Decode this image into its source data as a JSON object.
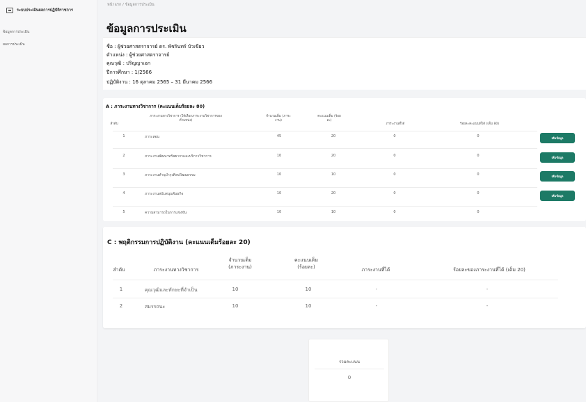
{
  "sidebar": {
    "brand": "ระบบประเมินผลการปฏิบัติราชการ",
    "items": [
      {
        "label": "ข้อมูลการประเมิน"
      },
      {
        "label": "ผลการประเมิน"
      }
    ]
  },
  "breadcrumb": "หน้าแรก / ข้อมูลการประเมิน",
  "page_title": "ข้อมูลการประเมิน",
  "info": {
    "name": "ชื่อ : ผู้ช่วยศาสตราจารย์ ดร. พัชรินทร์ บัวเขียว",
    "position": "ตำแหน่ง : ผู้ช่วยศาสตราจารย์",
    "qualification": "คุณวุฒิ : ปริญญาเอก",
    "semester": "ปีการศึกษา : 1/2566",
    "period": "ปฏิบัติงาน : 16 ตุลาคม 2565 – 31 มีนาคม 2566"
  },
  "section_a": {
    "title": "A : ภาระงานทางวิชาการ (คะแนนเต็มร้อยละ 80)",
    "headers": [
      "ลำดับ",
      "ภาระงานทางวิชาการ (ให้เลือกภาระงานวิชาการของตำแหน่ง)",
      "จำนวนเต็ม (ภาระงาน)",
      "คะแนนเต็ม (ร้อยละ)",
      "ภาระงานที่ได้",
      "ร้อยละคะแนนที่ได้ (เต็ม 80)"
    ],
    "rows": [
      {
        "no": "1",
        "task": "ภาระสอน",
        "full_load": "45",
        "full_score": "20",
        "got": "0",
        "percent": "0",
        "action": "เพิ่มข้อมูล"
      },
      {
        "no": "2",
        "task": "ภาระงานพัฒนาทรัพยากรและบริการวิชาการ",
        "full_load": "10",
        "full_score": "20",
        "got": "0",
        "percent": "0",
        "action": "เพิ่มข้อมูล"
      },
      {
        "no": "3",
        "task": "ภาระงานทำนุบำรุงศิลปวัฒนธรรม",
        "full_load": "10",
        "full_score": "10",
        "got": "0",
        "percent": "0",
        "action": "เพิ่มข้อมูล"
      },
      {
        "no": "4",
        "task": "ภาระงานสนับสนุนพันธกิจ",
        "full_load": "10",
        "full_score": "20",
        "got": "0",
        "percent": "0",
        "action": "เพิ่มข้อมูล"
      },
      {
        "no": "5",
        "task": "ความสามารถในการแข่งขัน",
        "full_load": "10",
        "full_score": "10",
        "got": "0",
        "percent": "0"
      }
    ]
  },
  "section_c": {
    "title": "C : พฤติกรรมการปฏิบัติงาน (คะแนนเต็มร้อยละ 20)",
    "headers": [
      "ลำดับ",
      "ภาระงานทางวิชาการ",
      "จำนวนเต็ม (ภาระงาน)",
      "คะแนนเต็ม (ร้อยละ)",
      "ภาระงานที่ได้",
      "ร้อยละของภาระงานที่ได้ (เต็ม 20)"
    ],
    "rows": [
      {
        "no": "1",
        "task": "คุณวุฒิและทักษะที่จำเป็น",
        "full_load": "10",
        "full_score": "10",
        "got": "-",
        "percent": "-"
      },
      {
        "no": "2",
        "task": "สมรรถนะ",
        "full_load": "10",
        "full_score": "10",
        "got": "-",
        "percent": "-"
      }
    ]
  },
  "summary": {
    "label": "รวมคะแนน",
    "value": "0"
  },
  "colors": {
    "accent": "#1d7a66",
    "background": "#f3f4f6"
  }
}
